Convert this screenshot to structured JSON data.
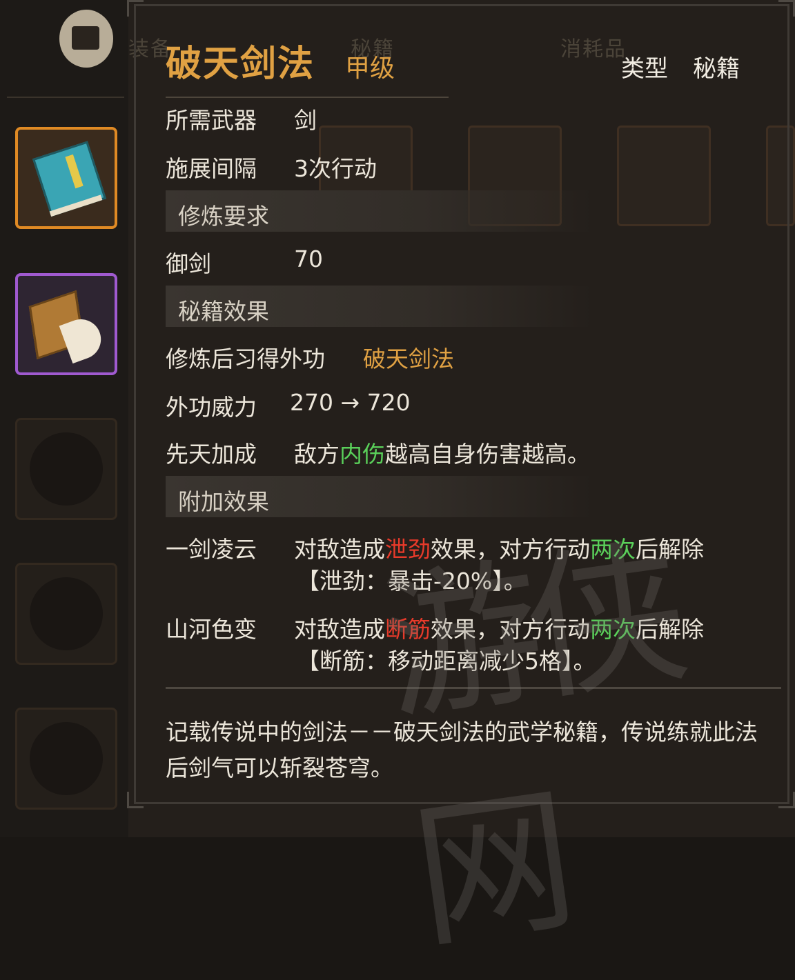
{
  "tabs": [
    "装备",
    "秘籍",
    "消耗品"
  ],
  "item": {
    "name": "破天剑法",
    "grade": "甲级",
    "type_label": "类型",
    "type_value": "秘籍"
  },
  "stats": {
    "weapon_label": "所需武器",
    "weapon_value": "剑",
    "interval_label": "施展间隔",
    "interval_value": "3次行动"
  },
  "requirements": {
    "header": "修炼要求",
    "skill_label": "御剑",
    "skill_value": "70"
  },
  "effects": {
    "header": "秘籍效果",
    "learn_label": "修炼后习得外功",
    "learn_value": "破天剑法",
    "power_label": "外功威力",
    "power_value": "270 → 720",
    "innate_label": "先天加成",
    "innate_pre": "敌方",
    "innate_highlight": "内伤",
    "innate_post": "越高自身伤害越高。"
  },
  "extra": {
    "header": "附加效果",
    "effect1": {
      "name": "一剑凌云",
      "pre": "对敌造成",
      "status": "泄劲",
      "mid": "效果，对方行动",
      "times": "两次",
      "post": "后解除",
      "detail": "【泄劲：暴击-20%】。"
    },
    "effect2": {
      "name": "山河色变",
      "pre": "对敌造成",
      "status": "断筋",
      "mid": "效果，对方行动",
      "times": "两次",
      "post": "后解除",
      "detail": "【断筋：移动距离减少5格】。"
    }
  },
  "description": "记载传说中的剑法－－破天剑法的武学秘籍，传说练就此法后剑气可以斩裂苍穹。",
  "watermark": "游侠网",
  "colors": {
    "gold": "#e0a143",
    "green": "#5ad05a",
    "red": "#e83a2a",
    "orange_frame": "#e08a24",
    "purple_frame": "#a05ad0"
  }
}
